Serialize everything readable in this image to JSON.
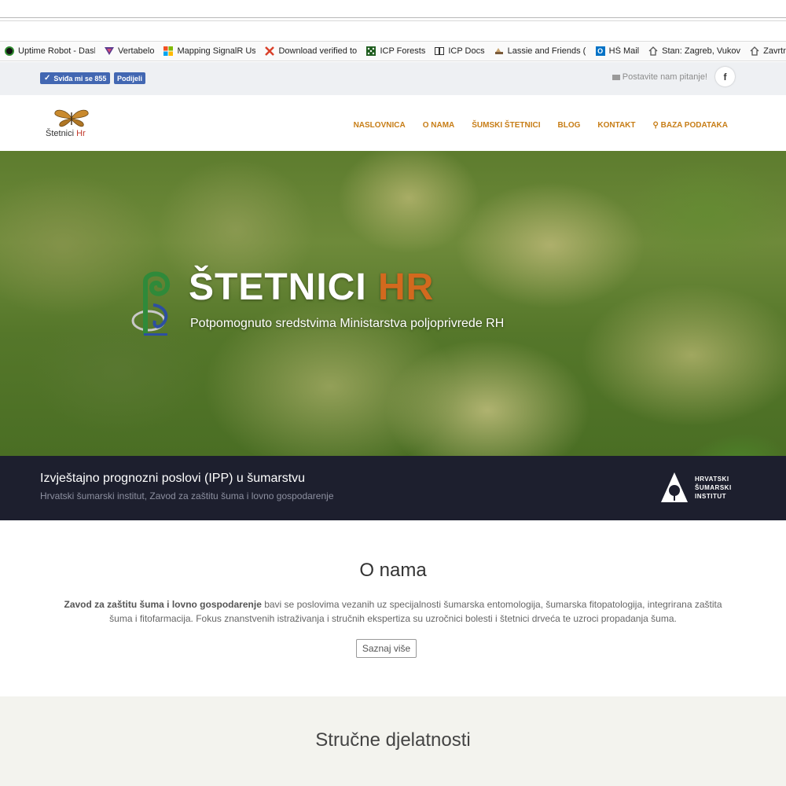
{
  "browser": {
    "bookmarks": [
      {
        "label": "Uptime Robot - Dashb",
        "icon": "uptime-robot-icon",
        "color": "#2e8b2e"
      },
      {
        "label": "Vertabelo",
        "icon": "vertabelo-icon",
        "color": "#5b3a8e"
      },
      {
        "label": "Mapping SignalR Usei",
        "icon": "microsoft-icon",
        "color": "#f25022"
      },
      {
        "label": "Download verified tor",
        "icon": "x-icon",
        "color": "#d9402a"
      },
      {
        "label": "ICP Forests",
        "icon": "icp-forests-icon",
        "color": "#1f5d1f"
      },
      {
        "label": "ICP Docs",
        "icon": "book-icon",
        "color": "#333333"
      },
      {
        "label": "Lassie and Friends (Le",
        "icon": "lassie-icon",
        "color": "#7a5a3a"
      },
      {
        "label": "HŠ Mail",
        "icon": "outlook-icon",
        "color": "#0072c6"
      },
      {
        "label": "Stan: Zagreb, Vukovar",
        "icon": "house-icon",
        "color": "#555555"
      },
      {
        "label": "Zavrtnica no",
        "icon": "house-icon",
        "color": "#555555"
      }
    ]
  },
  "topbar": {
    "like_label": "Sviđa mi se 855",
    "share_label": "Podijeli",
    "ask_label": "Postavite nam pitanje!",
    "facebook_glyph": "f"
  },
  "header": {
    "logo_name": "Štetnici",
    "logo_hr": "Hr",
    "nav": [
      {
        "label": "NASLOVNICA"
      },
      {
        "label": "O NAMA"
      },
      {
        "label": "ŠUMSKI ŠTETNICI"
      },
      {
        "label": "BLOG"
      },
      {
        "label": "KONTAKT"
      },
      {
        "label": "BAZA PODATAKA",
        "icon": "key-icon"
      }
    ]
  },
  "hero": {
    "title_main": "ŠTETNICI",
    "title_hr": "HR",
    "subtitle": "Potpomognuto sredstvima Ministarstva poljoprivrede RH"
  },
  "band": {
    "title": "Izvještajno prognozni poslovi (IPP) u šumarstvu",
    "subtitle": "Hrvatski šumarski institut, Zavod za zaštitu šuma i lovno gospodarenje",
    "institute_line1": "HRVATSKI",
    "institute_line2": "ŠUMARSKI",
    "institute_line3": "INSTITUT"
  },
  "about": {
    "title": "O nama",
    "text_bold": "Zavod za zaštitu šuma i lovno gospodarenje",
    "text_rest": " bavi se poslovima vezanih uz specijalnosti šumarska entomologija, šumarska fitopatologija, integrirana zaštita šuma i fitofarmacija. Fokus znanstvenih istraživanja i stručnih ekspertiza su uzročnici bolesti i štetnici drveća te uzroci propadanja šuma.",
    "button_label": "Saznaj više"
  },
  "strucne": {
    "title": "Stručne djelatnosti"
  },
  "colors": {
    "accent": "#c77d16",
    "hero_hr": "#d3691e",
    "band_bg": "#1d1f2e",
    "fb_blue": "#4267b2"
  }
}
